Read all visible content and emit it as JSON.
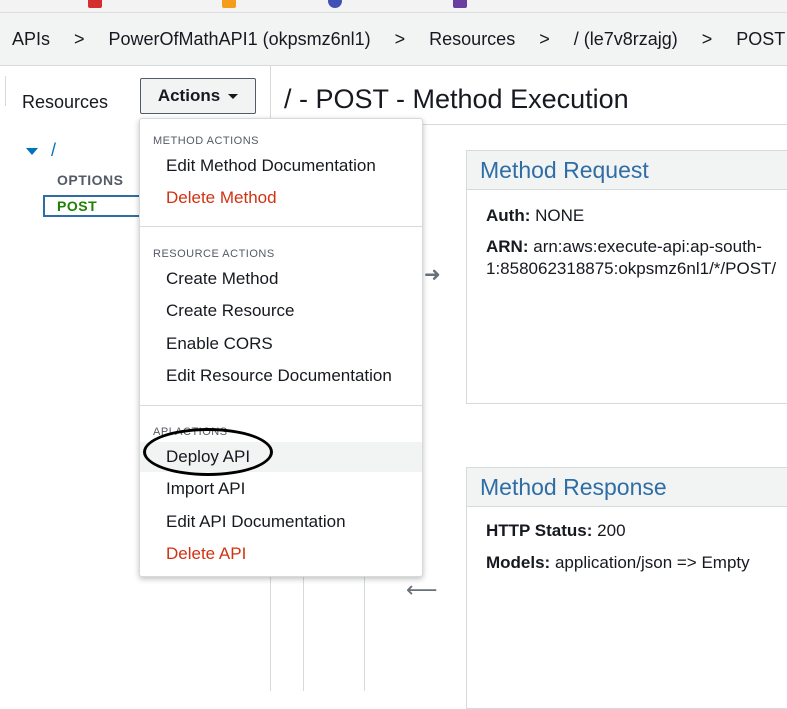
{
  "breadcrumb": {
    "items": [
      "APIs",
      "PowerOfMathAPI1 (okpsmz6nl1)",
      "Resources",
      "/ (le7v8rzajg)",
      "POST"
    ],
    "separator": ">"
  },
  "left_panel": {
    "title": "Resources",
    "actions_label": "Actions",
    "tree": {
      "root": "/",
      "methods": [
        "OPTIONS",
        "POST"
      ],
      "selected": "POST"
    }
  },
  "main": {
    "title": "/ - POST - Method Execution",
    "method_request": {
      "title": "Method Request",
      "auth_label": "Auth:",
      "auth_value": "NONE",
      "arn_label": "ARN:",
      "arn_value_line1": "arn:aws:execute-api:ap-south-",
      "arn_value_line2": "1:858062318875:okpsmz6nl1/*/POST/"
    },
    "method_response": {
      "title": "Method Response",
      "status_label": "HTTP Status:",
      "status_value": "200",
      "models_label": "Models:",
      "models_value": "application/json => Empty"
    }
  },
  "menu": {
    "method_actions": {
      "header": "METHOD ACTIONS",
      "items": [
        "Edit Method Documentation",
        "Delete Method"
      ]
    },
    "resource_actions": {
      "header": "RESOURCE ACTIONS",
      "items": [
        "Create Method",
        "Create Resource",
        "Enable CORS",
        "Edit Resource Documentation"
      ]
    },
    "api_actions": {
      "header": "API ACTIONS",
      "items": [
        "Deploy API",
        "Import API",
        "Edit API Documentation",
        "Delete API"
      ]
    }
  },
  "colors": {
    "link_blue": "#0073bb",
    "card_title_blue": "#2e6ea5",
    "danger_red": "#d13212",
    "method_green": "#1d8102",
    "panel_gray": "#f2f3f3"
  },
  "icons": [
    "caret-down-icon",
    "tree-expand-icon",
    "arrow-right-icon",
    "arrow-left-icon"
  ]
}
